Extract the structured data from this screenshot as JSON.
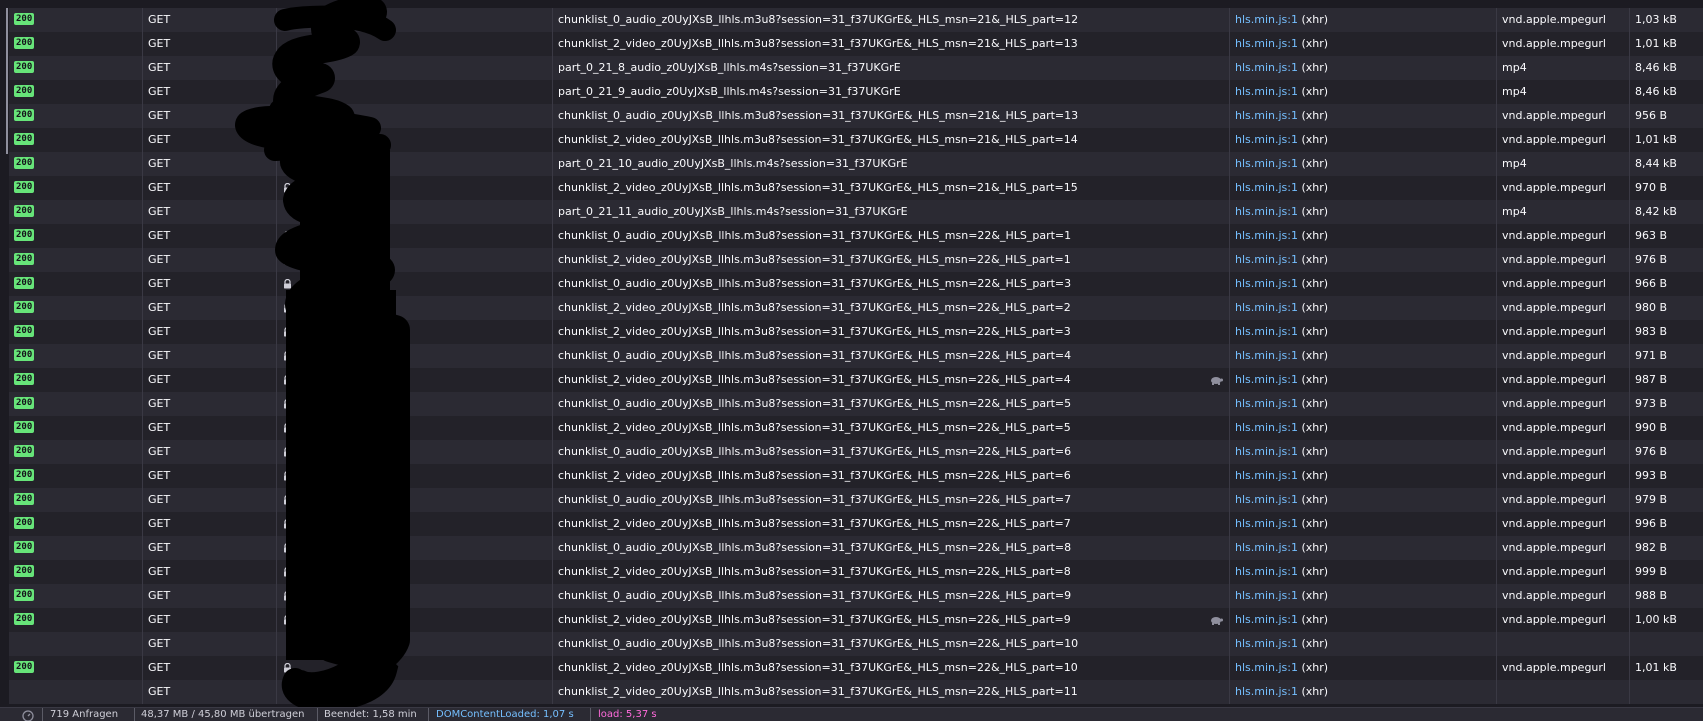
{
  "table": {
    "rows": [
      {
        "status": "200",
        "method": "GET",
        "file": "chunklist_0_audio_z0UyJXsB_llhls.m3u8?session=31_f37UKGrE&_HLS_msn=21&_HLS_part=12",
        "initiator_link": "hls.min.js:1",
        "initiator_suffix": "(xhr)",
        "type": "vnd.apple.mpegurl",
        "size": "1,03 kB",
        "lock": true,
        "throttle": false
      },
      {
        "status": "200",
        "method": "GET",
        "file": "chunklist_2_video_z0UyJXsB_llhls.m3u8?session=31_f37UKGrE&_HLS_msn=21&_HLS_part=13",
        "initiator_link": "hls.min.js:1",
        "initiator_suffix": "(xhr)",
        "type": "vnd.apple.mpegurl",
        "size": "1,01 kB",
        "lock": false,
        "throttle": false
      },
      {
        "status": "200",
        "method": "GET",
        "file": "part_0_21_8_audio_z0UyJXsB_llhls.m4s?session=31_f37UKGrE",
        "initiator_link": "hls.min.js:1",
        "initiator_suffix": "(xhr)",
        "type": "mp4",
        "size": "8,46 kB",
        "lock": false,
        "throttle": false
      },
      {
        "status": "200",
        "method": "GET",
        "file": "part_0_21_9_audio_z0UyJXsB_llhls.m4s?session=31_f37UKGrE",
        "initiator_link": "hls.min.js:1",
        "initiator_suffix": "(xhr)",
        "type": "mp4",
        "size": "8,46 kB",
        "lock": false,
        "throttle": false
      },
      {
        "status": "200",
        "method": "GET",
        "file": "chunklist_0_audio_z0UyJXsB_llhls.m3u8?session=31_f37UKGrE&_HLS_msn=21&_HLS_part=13",
        "initiator_link": "hls.min.js:1",
        "initiator_suffix": "(xhr)",
        "type": "vnd.apple.mpegurl",
        "size": "956 B",
        "lock": false,
        "throttle": false
      },
      {
        "status": "200",
        "method": "GET",
        "file": "chunklist_2_video_z0UyJXsB_llhls.m3u8?session=31_f37UKGrE&_HLS_msn=21&_HLS_part=14",
        "initiator_link": "hls.min.js:1",
        "initiator_suffix": "(xhr)",
        "type": "vnd.apple.mpegurl",
        "size": "1,01 kB",
        "lock": false,
        "throttle": false
      },
      {
        "status": "200",
        "method": "GET",
        "file": "part_0_21_10_audio_z0UyJXsB_llhls.m4s?session=31_f37UKGrE",
        "initiator_link": "hls.min.js:1",
        "initiator_suffix": "(xhr)",
        "type": "mp4",
        "size": "8,44 kB",
        "lock": true,
        "throttle": false
      },
      {
        "status": "200",
        "method": "GET",
        "file": "chunklist_2_video_z0UyJXsB_llhls.m3u8?session=31_f37UKGrE&_HLS_msn=21&_HLS_part=15",
        "initiator_link": "hls.min.js:1",
        "initiator_suffix": "(xhr)",
        "type": "vnd.apple.mpegurl",
        "size": "970 B",
        "lock": true,
        "throttle": false
      },
      {
        "status": "200",
        "method": "GET",
        "file": "part_0_21_11_audio_z0UyJXsB_llhls.m4s?session=31_f37UKGrE",
        "initiator_link": "hls.min.js:1",
        "initiator_suffix": "(xhr)",
        "type": "mp4",
        "size": "8,42 kB",
        "lock": false,
        "throttle": false
      },
      {
        "status": "200",
        "method": "GET",
        "file": "chunklist_0_audio_z0UyJXsB_llhls.m3u8?session=31_f37UKGrE&_HLS_msn=22&_HLS_part=1",
        "initiator_link": "hls.min.js:1",
        "initiator_suffix": "(xhr)",
        "type": "vnd.apple.mpegurl",
        "size": "963 B",
        "lock": true,
        "throttle": false
      },
      {
        "status": "200",
        "method": "GET",
        "file": "chunklist_2_video_z0UyJXsB_llhls.m3u8?session=31_f37UKGrE&_HLS_msn=22&_HLS_part=1",
        "initiator_link": "hls.min.js:1",
        "initiator_suffix": "(xhr)",
        "type": "vnd.apple.mpegurl",
        "size": "976 B",
        "lock": true,
        "throttle": false
      },
      {
        "status": "200",
        "method": "GET",
        "file": "chunklist_0_audio_z0UyJXsB_llhls.m3u8?session=31_f37UKGrE&_HLS_msn=22&_HLS_part=3",
        "initiator_link": "hls.min.js:1",
        "initiator_suffix": "(xhr)",
        "type": "vnd.apple.mpegurl",
        "size": "966 B",
        "lock": true,
        "throttle": false
      },
      {
        "status": "200",
        "method": "GET",
        "file": "chunklist_2_video_z0UyJXsB_llhls.m3u8?session=31_f37UKGrE&_HLS_msn=22&_HLS_part=2",
        "initiator_link": "hls.min.js:1",
        "initiator_suffix": "(xhr)",
        "type": "vnd.apple.mpegurl",
        "size": "980 B",
        "lock": true,
        "throttle": false
      },
      {
        "status": "200",
        "method": "GET",
        "file": "chunklist_2_video_z0UyJXsB_llhls.m3u8?session=31_f37UKGrE&_HLS_msn=22&_HLS_part=3",
        "initiator_link": "hls.min.js:1",
        "initiator_suffix": "(xhr)",
        "type": "vnd.apple.mpegurl",
        "size": "983 B",
        "lock": true,
        "throttle": false
      },
      {
        "status": "200",
        "method": "GET",
        "file": "chunklist_0_audio_z0UyJXsB_llhls.m3u8?session=31_f37UKGrE&_HLS_msn=22&_HLS_part=4",
        "initiator_link": "hls.min.js:1",
        "initiator_suffix": "(xhr)",
        "type": "vnd.apple.mpegurl",
        "size": "971 B",
        "lock": true,
        "throttle": false
      },
      {
        "status": "200",
        "method": "GET",
        "file": "chunklist_2_video_z0UyJXsB_llhls.m3u8?session=31_f37UKGrE&_HLS_msn=22&_HLS_part=4",
        "initiator_link": "hls.min.js:1",
        "initiator_suffix": "(xhr)",
        "type": "vnd.apple.mpegurl",
        "size": "987 B",
        "lock": true,
        "throttle": true
      },
      {
        "status": "200",
        "method": "GET",
        "file": "chunklist_0_audio_z0UyJXsB_llhls.m3u8?session=31_f37UKGrE&_HLS_msn=22&_HLS_part=5",
        "initiator_link": "hls.min.js:1",
        "initiator_suffix": "(xhr)",
        "type": "vnd.apple.mpegurl",
        "size": "973 B",
        "lock": true,
        "throttle": false
      },
      {
        "status": "200",
        "method": "GET",
        "file": "chunklist_2_video_z0UyJXsB_llhls.m3u8?session=31_f37UKGrE&_HLS_msn=22&_HLS_part=5",
        "initiator_link": "hls.min.js:1",
        "initiator_suffix": "(xhr)",
        "type": "vnd.apple.mpegurl",
        "size": "990 B",
        "lock": true,
        "throttle": false
      },
      {
        "status": "200",
        "method": "GET",
        "file": "chunklist_0_audio_z0UyJXsB_llhls.m3u8?session=31_f37UKGrE&_HLS_msn=22&_HLS_part=6",
        "initiator_link": "hls.min.js:1",
        "initiator_suffix": "(xhr)",
        "type": "vnd.apple.mpegurl",
        "size": "976 B",
        "lock": true,
        "throttle": false
      },
      {
        "status": "200",
        "method": "GET",
        "file": "chunklist_2_video_z0UyJXsB_llhls.m3u8?session=31_f37UKGrE&_HLS_msn=22&_HLS_part=6",
        "initiator_link": "hls.min.js:1",
        "initiator_suffix": "(xhr)",
        "type": "vnd.apple.mpegurl",
        "size": "993 B",
        "lock": true,
        "throttle": false
      },
      {
        "status": "200",
        "method": "GET",
        "file": "chunklist_0_audio_z0UyJXsB_llhls.m3u8?session=31_f37UKGrE&_HLS_msn=22&_HLS_part=7",
        "initiator_link": "hls.min.js:1",
        "initiator_suffix": "(xhr)",
        "type": "vnd.apple.mpegurl",
        "size": "979 B",
        "lock": true,
        "throttle": false
      },
      {
        "status": "200",
        "method": "GET",
        "file": "chunklist_2_video_z0UyJXsB_llhls.m3u8?session=31_f37UKGrE&_HLS_msn=22&_HLS_part=7",
        "initiator_link": "hls.min.js:1",
        "initiator_suffix": "(xhr)",
        "type": "vnd.apple.mpegurl",
        "size": "996 B",
        "lock": true,
        "throttle": false
      },
      {
        "status": "200",
        "method": "GET",
        "file": "chunklist_0_audio_z0UyJXsB_llhls.m3u8?session=31_f37UKGrE&_HLS_msn=22&_HLS_part=8",
        "initiator_link": "hls.min.js:1",
        "initiator_suffix": "(xhr)",
        "type": "vnd.apple.mpegurl",
        "size": "982 B",
        "lock": true,
        "throttle": false
      },
      {
        "status": "200",
        "method": "GET",
        "file": "chunklist_2_video_z0UyJXsB_llhls.m3u8?session=31_f37UKGrE&_HLS_msn=22&_HLS_part=8",
        "initiator_link": "hls.min.js:1",
        "initiator_suffix": "(xhr)",
        "type": "vnd.apple.mpegurl",
        "size": "999 B",
        "lock": true,
        "throttle": false
      },
      {
        "status": "200",
        "method": "GET",
        "file": "chunklist_0_audio_z0UyJXsB_llhls.m3u8?session=31_f37UKGrE&_HLS_msn=22&_HLS_part=9",
        "initiator_link": "hls.min.js:1",
        "initiator_suffix": "(xhr)",
        "type": "vnd.apple.mpegurl",
        "size": "988 B",
        "lock": true,
        "throttle": false
      },
      {
        "status": "200",
        "method": "GET",
        "file": "chunklist_2_video_z0UyJXsB_llhls.m3u8?session=31_f37UKGrE&_HLS_msn=22&_HLS_part=9",
        "initiator_link": "hls.min.js:1",
        "initiator_suffix": "(xhr)",
        "type": "vnd.apple.mpegurl",
        "size": "1,00 kB",
        "lock": true,
        "throttle": true
      },
      {
        "status": "",
        "method": "GET",
        "file": "chunklist_0_audio_z0UyJXsB_llhls.m3u8?session=31_f37UKGrE&_HLS_msn=22&_HLS_part=10",
        "initiator_link": "hls.min.js:1",
        "initiator_suffix": "(xhr)",
        "type": "",
        "size": "",
        "lock": false,
        "throttle": false
      },
      {
        "status": "200",
        "method": "GET",
        "file": "chunklist_2_video_z0UyJXsB_llhls.m3u8?session=31_f37UKGrE&_HLS_msn=22&_HLS_part=10",
        "initiator_link": "hls.min.js:1",
        "initiator_suffix": "(xhr)",
        "type": "vnd.apple.mpegurl",
        "size": "1,01 kB",
        "lock": true,
        "throttle": false
      },
      {
        "status": "",
        "method": "GET",
        "file": "chunklist_2_video_z0UyJXsB_llhls.m3u8?session=31_f37UKGrE&_HLS_msn=22&_HLS_part=11",
        "initiator_link": "hls.min.js:1",
        "initiator_suffix": "(xhr)",
        "type": "",
        "size": "",
        "lock": false,
        "throttle": false
      }
    ]
  },
  "statusbar": {
    "icon": "timer-icon",
    "requests": "719 Anfragen",
    "transferred": "48,37 MB / 45,80 MB übertragen",
    "finished": "Beendet: 1,58 min",
    "dom_content_loaded": "DOMContentLoaded: 1,07 s",
    "load": "load: 5,37 s"
  },
  "colors": {
    "status_ok": "#67e479",
    "link": "#75bfff",
    "load": "#ff6bdb",
    "row_odd": "#2b2a33",
    "row_even": "#232229"
  },
  "icons": {
    "lock": "lock-icon",
    "throttle": "turtle-icon"
  }
}
